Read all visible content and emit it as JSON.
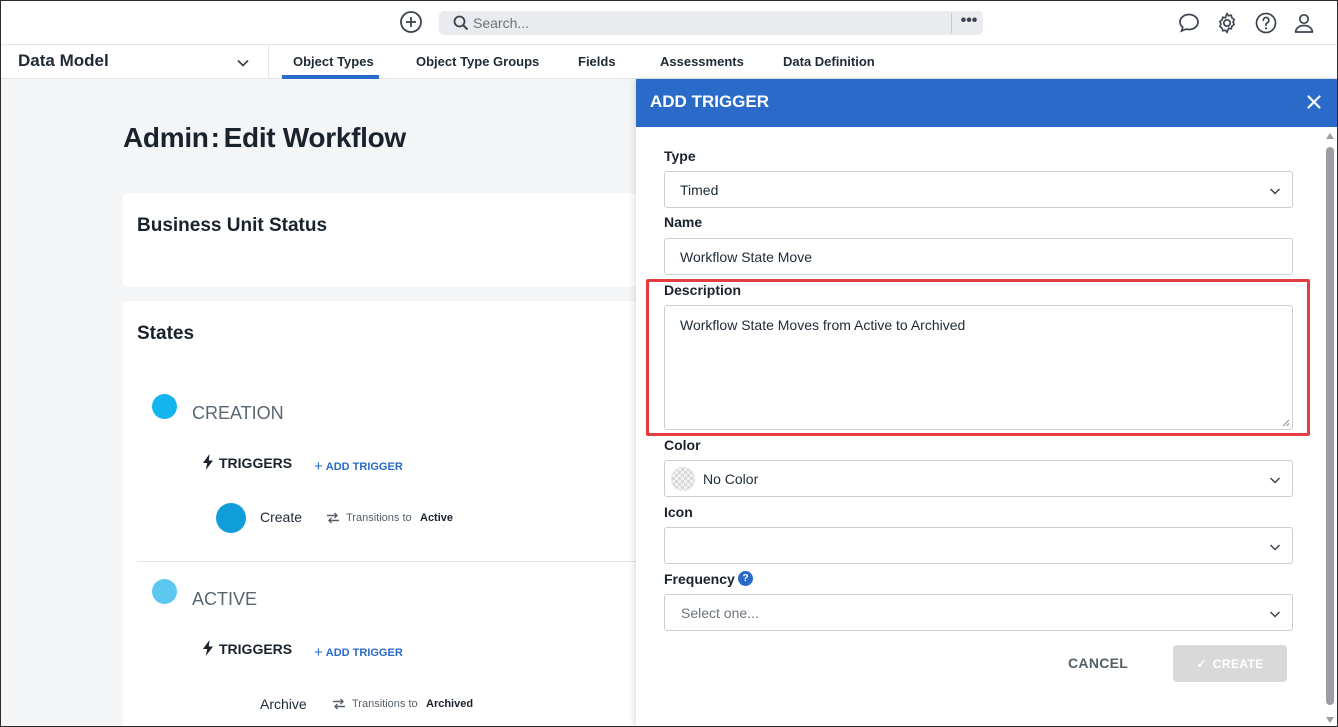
{
  "topbar": {
    "search_placeholder": "Search...",
    "more_label": "•••",
    "icons": [
      "add-circle-icon",
      "search-icon",
      "chat-icon",
      "gear-icon",
      "help-icon",
      "user-icon"
    ]
  },
  "nav": {
    "module": "Data Model",
    "tabs": [
      {
        "label": "Object Types",
        "active": true
      },
      {
        "label": "Object Type Groups",
        "active": false
      },
      {
        "label": "Fields",
        "active": false
      },
      {
        "label": "Assessments",
        "active": false
      },
      {
        "label": "Data Definition",
        "active": false
      }
    ]
  },
  "page": {
    "title_prefix": "Admin",
    "title_sep": ":",
    "title_main": "Edit Workflow",
    "workflow_name": "Business Unit Status",
    "states_heading": "States",
    "states": [
      {
        "name": "CREATION",
        "color": "#12b5f0",
        "triggers_label": "TRIGGERS",
        "add_trigger_label": "ADD TRIGGER",
        "triggers": [
          {
            "name": "Create",
            "transition_text": "Transitions to",
            "target": "Active"
          }
        ]
      },
      {
        "name": "ACTIVE",
        "color": "#5cc8f2",
        "triggers_label": "TRIGGERS",
        "add_trigger_label": "ADD TRIGGER",
        "triggers": [
          {
            "name": "Archive",
            "transition_text": "Transitions to",
            "target": "Archived"
          }
        ]
      }
    ]
  },
  "modal": {
    "title": "ADD TRIGGER",
    "header_color": "#2a6ac8",
    "fields": {
      "type": {
        "label": "Type",
        "value": "Timed"
      },
      "name": {
        "label": "Name",
        "value": "Workflow State Move"
      },
      "description": {
        "label": "Description",
        "value": "Workflow State Moves from Active to Archived"
      },
      "color": {
        "label": "Color",
        "value": "No Color"
      },
      "icon": {
        "label": "Icon",
        "value": ""
      },
      "frequency": {
        "label": "Frequency",
        "placeholder": "Select one...",
        "help": "?"
      }
    },
    "cancel_label": "CANCEL",
    "create_label": "CREATE"
  },
  "highlight_color": "#e33d41"
}
